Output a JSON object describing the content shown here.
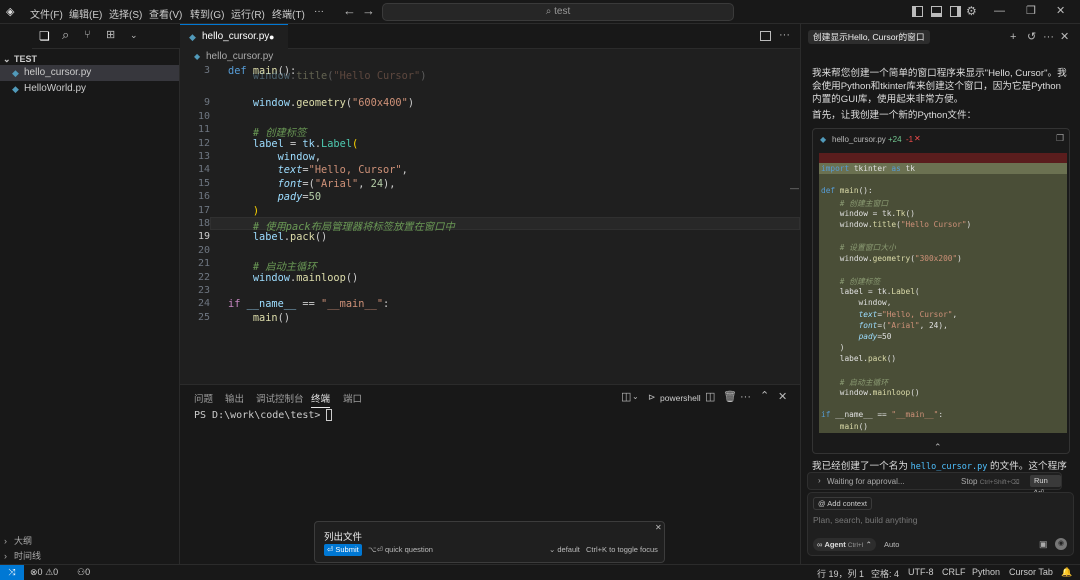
{
  "menubar": {
    "items": [
      "文件(F)",
      "编辑(E)",
      "选择(S)",
      "查看(V)",
      "转到(G)",
      "运行(R)",
      "终端(T)"
    ],
    "more": "···",
    "search_placeholder": "test"
  },
  "sidebar": {
    "folder": "TEST",
    "files": [
      "hello_cursor.py",
      "HelloWorld.py"
    ],
    "outline": "大纲",
    "timeline": "时间线"
  },
  "editor": {
    "tab_label": "hello_cursor.py",
    "breadcrumb": "hello_cursor.py",
    "lines": [
      {
        "n": "8",
        "html": "    <span class='var'>window</span>.<span class='fn'>title</span>(<span class='str'>\"Hello Cursor\"</span>)"
      },
      {
        "n": "9",
        "html": "    <span class='var'>window</span>.<span class='fn'>geometry</span>(<span class='str'>\"600x400\"</span>)"
      },
      {
        "n": "10",
        "html": ""
      },
      {
        "n": "11",
        "html": "    <span class='cm'># 创建标签</span>"
      },
      {
        "n": "12",
        "html": "    <span class='var'>label</span> = <span class='var'>tk</span>.<span class='cls'>Label</span><span class='pl'>(</span>"
      },
      {
        "n": "13",
        "html": "        <span class='var'>window</span>,"
      },
      {
        "n": "14",
        "html": "        <span class='prm'>text</span>=<span class='str'>\"Hello, Cursor\"</span>,"
      },
      {
        "n": "15",
        "html": "        <span class='prm'>font</span>=(<span class='str'>\"Arial\"</span>, <span class='num'>24</span>),"
      },
      {
        "n": "16",
        "html": "        <span class='prm'>pady</span>=<span class='num'>50</span>"
      },
      {
        "n": "17",
        "html": "    <span class='pl'>)</span>"
      },
      {
        "n": "18",
        "html": "    <span class='cm'># 使用pack布局管理器将标签放置在窗口中</span>"
      },
      {
        "n": "19",
        "html": "    <span class='var'>label</span>.<span class='fn'>pack</span>()"
      },
      {
        "n": "20",
        "html": ""
      },
      {
        "n": "21",
        "html": "    <span class='cm'># 启动主循环</span>"
      },
      {
        "n": "22",
        "html": "    <span class='var'>window</span>.<span class='fn'>mainloop</span>()"
      },
      {
        "n": "23",
        "html": ""
      },
      {
        "n": "24",
        "html": "<span class='kw'>if</span> <span class='var'>__name__</span> == <span class='str'>\"__main__\"</span>:"
      },
      {
        "n": "25",
        "html": "    <span class='fn'>main</span>()"
      }
    ],
    "line3_num": "3",
    "line3_html": "<span class='dkw'>def</span> <span class='fn'>main</span>():"
  },
  "panel": {
    "tabs": [
      "问题",
      "输出",
      "调试控制台",
      "终端",
      "端口"
    ],
    "active_tab": "终端",
    "shell": "powershell",
    "prompt": "PS D:\\work\\code\\test>"
  },
  "quick_input": {
    "value": "列出文件",
    "submit": "Submit",
    "quick_question": "quick question",
    "mode": "default",
    "toggle_hint": "Ctrl+K to toggle focus"
  },
  "chat": {
    "title": "创建显示Hello, Cursor的窗口",
    "message1": "我来帮您创建一个简单的窗口程序来显示\"Hello, Cursor\"。我会使用Python和tkinter库来创建这个窗口，因为它是Python内置的GUI库，使用起来非常方便。",
    "message2": "首先，让我创建一个新的Python文件：",
    "diff_file": "hello_cursor.py",
    "diff_added": "+24",
    "diff_removed": "-1",
    "message3_prefix": "我已经创建了一个名为",
    "message3_file": "hello_cursor.py",
    "message3_suffix": "的文件。这个程序会",
    "waiting": "Waiting for approval...",
    "stop": "Stop",
    "stop_shortcut": "Ctrl+Shift+⌫",
    "run": "Run ^⏎",
    "add_context": "Add context",
    "input_placeholder": "Plan, search, build anything",
    "agent": "Agent",
    "agent_shortcut": "Ctrl+I",
    "auto": "Auto"
  },
  "diff_lines": [
    "<span class='dkw'>import</span> tkinter <span class='dkw'>as</span> tk",
    "",
    "<span class='dkw'>def</span> <span class='dfn'>main</span>():",
    "    <span class='dcm'># 创建主窗口</span>",
    "    window = tk.<span class='dfn'>Tk</span>()",
    "    window.<span class='dfn'>title</span>(<span class='dst'>\"Hello Cursor\"</span>)",
    "",
    "    <span class='dcm'># 设置窗口大小</span>",
    "    window.<span class='dfn'>geometry</span>(<span class='dst'>\"300x200\"</span>)",
    "",
    "    <span class='dcm'># 创建标签</span>",
    "    label = tk.<span class='dfn'>Label</span>(",
    "        window,",
    "        <span class='prm'>text</span>=<span class='dst'>\"Hello, Cursor\"</span>,",
    "        <span class='prm'>font</span>=(<span class='dst'>\"Arial\"</span>, 24),",
    "        <span class='prm'>pady</span>=50",
    "    )",
    "    label.<span class='dfn'>pack</span>()",
    "",
    "    <span class='dcm'># 启动主循环</span>",
    "    window.<span class='dfn'>mainloop</span>()",
    "",
    "<span class='dkw'>if</span> __name__ == <span class='dst'>\"__main__\"</span>:",
    "    <span class='dfn'>main</span>()"
  ],
  "statusbar": {
    "errors": "0",
    "warnings": "0",
    "ports": "0",
    "position": "行 19，列 1",
    "spaces": "空格: 4",
    "encoding": "UTF-8",
    "eol": "CRLF",
    "language": "Python",
    "tab": "Cursor Tab"
  },
  "colors": {
    "accent": "#0078d4",
    "diff_bg": "#4a4e37",
    "diff_removed": "#5a1d1d"
  }
}
